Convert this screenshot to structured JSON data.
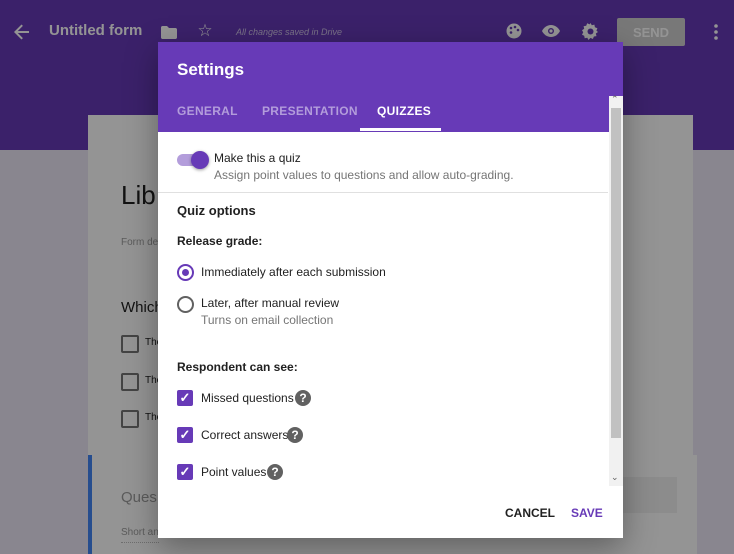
{
  "colors": {
    "primary": "#673ab7",
    "accent": "#673ab7"
  },
  "toolbar": {
    "back_icon": "arrow-left-icon",
    "title": "Untitled form",
    "folder_icon": "folder-icon",
    "star_icon": "star-outline-icon",
    "save_status": "All changes saved in Drive",
    "palette_icon": "palette-icon",
    "preview_icon": "eye-icon",
    "settings_icon": "gear-icon",
    "send_label": "SEND",
    "more_icon": "more-vert-icon"
  },
  "background_form": {
    "title_partial": "Lib",
    "description_partial": "Form de",
    "question_partial": "Which",
    "options_partial": [
      "The",
      "The",
      "The"
    ],
    "question2_partial": "Ques",
    "short_answer_partial": "Short an"
  },
  "dialog": {
    "title": "Settings",
    "tabs": [
      {
        "label": "GENERAL",
        "active": false
      },
      {
        "label": "PRESENTATION",
        "active": false
      },
      {
        "label": "QUIZZES",
        "active": true
      }
    ],
    "quiz_toggle": {
      "label": "Make this a quiz",
      "description": "Assign point values to questions and allow auto-grading.",
      "on": true
    },
    "quiz_options_heading": "Quiz options",
    "release_grade": {
      "heading": "Release grade:",
      "options": [
        {
          "label": "Immediately after each submission",
          "sub": "",
          "selected": true
        },
        {
          "label": "Later, after manual review",
          "sub": "Turns on email collection",
          "selected": false
        }
      ]
    },
    "respondent_can_see": {
      "heading": "Respondent can see:",
      "items": [
        {
          "label": "Missed questions",
          "checked": true,
          "help_icon": "help-icon"
        },
        {
          "label": "Correct answers",
          "checked": true,
          "help_icon": "help-icon"
        },
        {
          "label": "Point values",
          "checked": true,
          "help_icon": "help-icon"
        }
      ]
    },
    "cancel_label": "CANCEL",
    "save_label": "SAVE"
  }
}
